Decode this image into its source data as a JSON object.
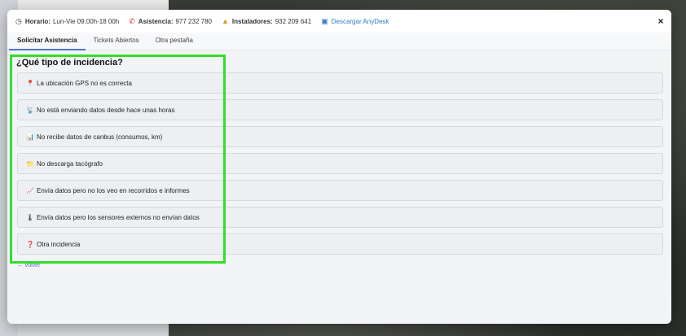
{
  "info_bar": {
    "schedule_label": "Horario:",
    "schedule_value": "Lun-Vie 09.00h-18 00h",
    "assistance_label": "Asistencia:",
    "assistance_value": "977 232 780",
    "installers_label": "Instaladores:",
    "installers_value": "932 209 641",
    "download_link": "Descargar AnyDesk",
    "close": "×"
  },
  "tabs": [
    {
      "label": "Solicitar Asistencia",
      "active": true
    },
    {
      "label": "Tickets Abiertos",
      "active": false
    },
    {
      "label": "Otra pestaña",
      "active": false
    }
  ],
  "question": "¿Qué tipo de incidencia?",
  "options": [
    {
      "icon": "map-pin-icon",
      "glyph": "📍",
      "label": "La ubicación GPS no es correcta"
    },
    {
      "icon": "satellite-icon",
      "glyph": "📡",
      "label": "No está enviando datos desde hace unas horas"
    },
    {
      "icon": "bar-chart-icon",
      "glyph": "📊",
      "label": "No recibe datos de canbus (consumos, km)"
    },
    {
      "icon": "folder-icon",
      "glyph": "📁",
      "label": "No descarga tacógrafo"
    },
    {
      "icon": "line-chart-icon",
      "glyph": "📈",
      "label": "Envía datos pero no los veo en recorridos e informes"
    },
    {
      "icon": "thermometer-icon",
      "glyph": "🌡",
      "label": "Envía datos pero los sensores externos no envían datos"
    },
    {
      "icon": "question-mark-icon",
      "glyph": "❓",
      "label": "Otra incidencia"
    }
  ],
  "back_link": "← Volver",
  "colors": {
    "highlight": "#33dd2b",
    "accent": "#4a78c9",
    "phone_icon": "#c23a2b"
  }
}
